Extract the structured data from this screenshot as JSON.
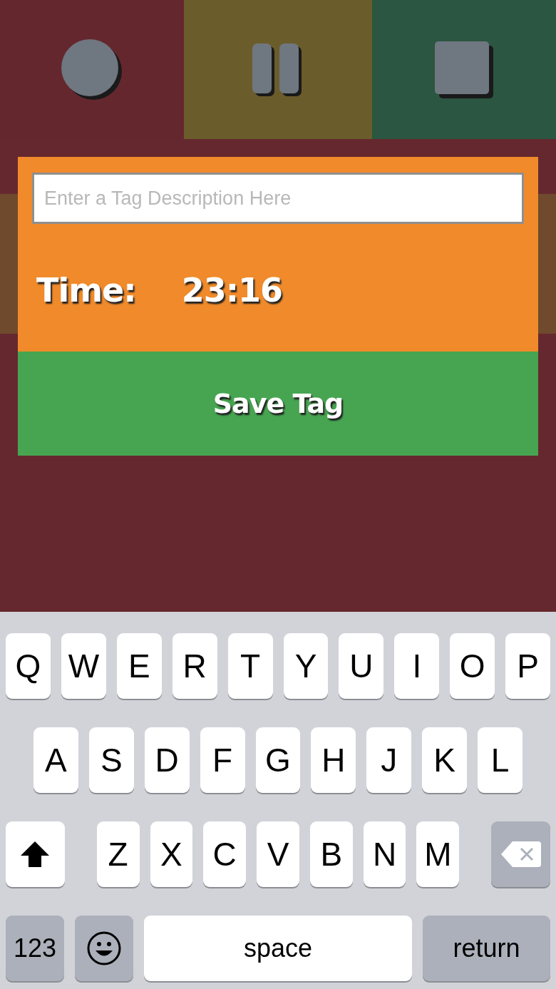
{
  "controls": [
    {
      "kind": "record",
      "color": "#65272e"
    },
    {
      "kind": "pause",
      "color": "#6b5c2b"
    },
    {
      "kind": "stop",
      "color": "#2b5641"
    }
  ],
  "tag_panel": {
    "description_field": {
      "placeholder": "Enter a Tag Description Here"
    },
    "time_label": "Time:",
    "time_value": "23:16",
    "save_button": "Save Tag"
  },
  "keyboard": {
    "rows": [
      [
        {
          "kind": "letter",
          "label": "Q"
        },
        {
          "kind": "letter",
          "label": "W"
        },
        {
          "kind": "letter",
          "label": "E"
        },
        {
          "kind": "letter",
          "label": "R"
        },
        {
          "kind": "letter",
          "label": "T"
        },
        {
          "kind": "letter",
          "label": "Y"
        },
        {
          "kind": "letter",
          "label": "U"
        },
        {
          "kind": "letter",
          "label": "I"
        },
        {
          "kind": "letter",
          "label": "O"
        },
        {
          "kind": "letter",
          "label": "P"
        }
      ],
      [
        {
          "kind": "letter",
          "label": "A"
        },
        {
          "kind": "letter",
          "label": "S"
        },
        {
          "kind": "letter",
          "label": "D"
        },
        {
          "kind": "letter",
          "label": "F"
        },
        {
          "kind": "letter",
          "label": "G"
        },
        {
          "kind": "letter",
          "label": "H"
        },
        {
          "kind": "letter",
          "label": "J"
        },
        {
          "kind": "letter",
          "label": "K"
        },
        {
          "kind": "letter",
          "label": "L"
        }
      ],
      [
        {
          "kind": "shift"
        },
        {
          "kind": "letter",
          "label": "Z"
        },
        {
          "kind": "letter",
          "label": "X"
        },
        {
          "kind": "letter",
          "label": "C"
        },
        {
          "kind": "letter",
          "label": "V"
        },
        {
          "kind": "letter",
          "label": "B"
        },
        {
          "kind": "letter",
          "label": "N"
        },
        {
          "kind": "letter",
          "label": "M"
        },
        {
          "kind": "delete"
        }
      ]
    ],
    "bottom_bar": {
      "numbers_key": "123",
      "space_key": "space",
      "return_key": "return"
    }
  }
}
